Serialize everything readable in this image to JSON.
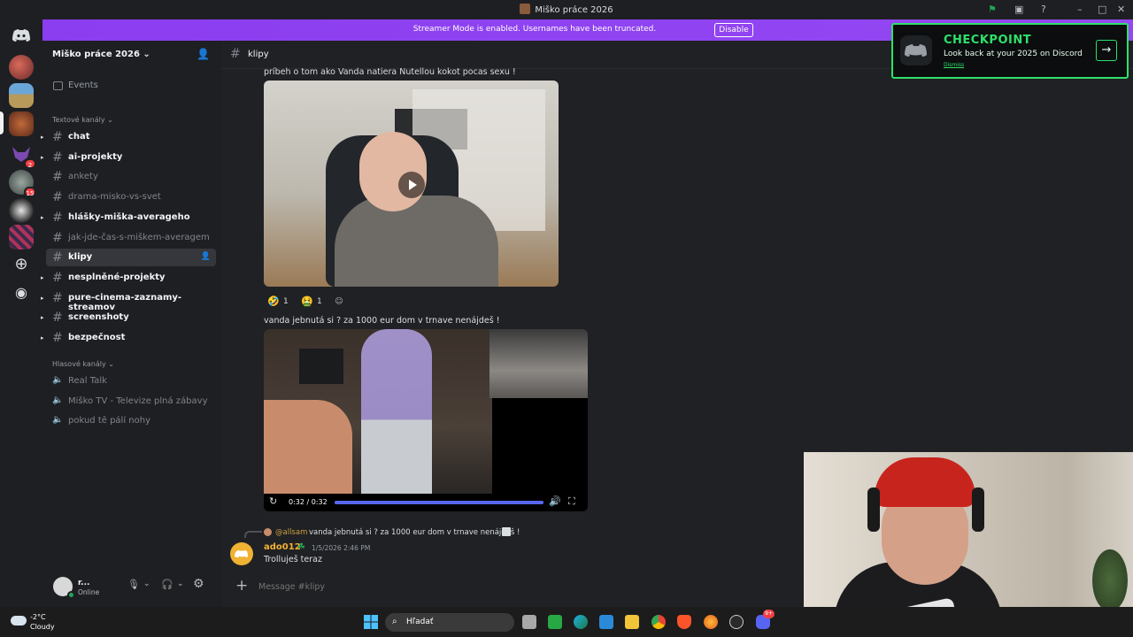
{
  "window": {
    "title": "Miško práce 2026"
  },
  "banner": {
    "text": "Streamer Mode is enabled. Usernames have been truncated.",
    "button": "Disable"
  },
  "rail": {
    "badges": [
      "2",
      "15"
    ]
  },
  "guild": {
    "name": "Miško práce 2026"
  },
  "sidebar": {
    "events_label": "Events",
    "text_category": "Textové kanály",
    "voice_category": "Hlasové kanály",
    "text_channels": [
      {
        "name": "chat",
        "state": "unread"
      },
      {
        "name": "ai-projekty",
        "state": "unread"
      },
      {
        "name": "ankety",
        "state": "read"
      },
      {
        "name": "drama-misko-vs-svet",
        "state": "read"
      },
      {
        "name": "hlášky-miška-averageho",
        "state": "unread"
      },
      {
        "name": "jak-jde-čas-s-miškem-averagem",
        "state": "read"
      },
      {
        "name": "klipy",
        "state": "active"
      },
      {
        "name": "nesplněné-projekty",
        "state": "unread"
      },
      {
        "name": "pure-cinema-zaznamy-streamov",
        "state": "unread"
      },
      {
        "name": "screenshoty",
        "state": "unread"
      },
      {
        "name": "bezpečnost",
        "state": "unread"
      }
    ],
    "voice_channels": [
      {
        "name": "Real Talk"
      },
      {
        "name": "Miško TV - Televize plná zábavy"
      },
      {
        "name": "pokud tě pálí nohy"
      }
    ]
  },
  "user": {
    "name": "r...",
    "status": "Online"
  },
  "channel": {
    "name": "klipy"
  },
  "messages": {
    "m1_text": "príbeh o tom ako Vanda natiera Nutellou kokot pocas sexu !",
    "reactions": [
      {
        "emoji": "🤣",
        "count": "1"
      },
      {
        "emoji": "🤮",
        "count": "1"
      }
    ],
    "m2_text": "vanda jebnutá si ? za 1000 eur dom v trnave nenájdeš !",
    "video_time": "0:32 / 0:32",
    "video_progress": 1.0,
    "reply_author": "@allsam",
    "reply_text": "vanda jebnutá si ? za 1000 eur dom v trnave nenájdeš !",
    "author": "ado012",
    "timestamp": "1/5/2026 2:46 PM",
    "m3_text": "Trolluješ teraz"
  },
  "composer": {
    "placeholder": "Message #klipy"
  },
  "checkpoint": {
    "title": "CHECKPOINT",
    "subtitle": "Look back at your 2025 on Discord",
    "dismiss": "Dismiss"
  },
  "taskbar": {
    "weather_temp": "-2°C",
    "weather_desc": "Cloudy",
    "search_placeholder": "Hľadať",
    "discord_badge": "9+"
  },
  "colors": {
    "accent": "#5865f2",
    "banner": "#9448f2",
    "checkpoint": "#2ee06a",
    "online": "#23a55a"
  }
}
